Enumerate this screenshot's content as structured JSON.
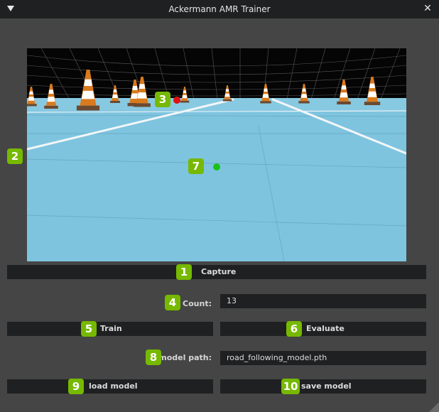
{
  "window": {
    "title": "Ackermann AMR Trainer",
    "close_glyph": "✕"
  },
  "markers": {
    "m1": "1",
    "m2": "2",
    "m3": "3",
    "m4": "4",
    "m5": "5",
    "m6": "6",
    "m7": "7",
    "m8": "8",
    "m9": "9",
    "m10": "10"
  },
  "controls": {
    "capture_label": "Capture",
    "count_label": "Count:",
    "count_value": "13",
    "train_label": "Train",
    "evaluate_label": "Evaluate",
    "model_path_label": "model path:",
    "model_path_value": "road_following_model.pth",
    "load_model_label": "load model",
    "save_model_label": "save model"
  },
  "icons": {
    "collapse": "triangle-down-icon",
    "close": "close-icon",
    "resize": "resize-grip-icon"
  },
  "colors": {
    "accent_badge": "#76b900",
    "panel_bg": "#454545",
    "control_bg": "#1f2021",
    "floor": "#7ec4df",
    "target_red": "#e01010",
    "target_green": "#19c219"
  }
}
